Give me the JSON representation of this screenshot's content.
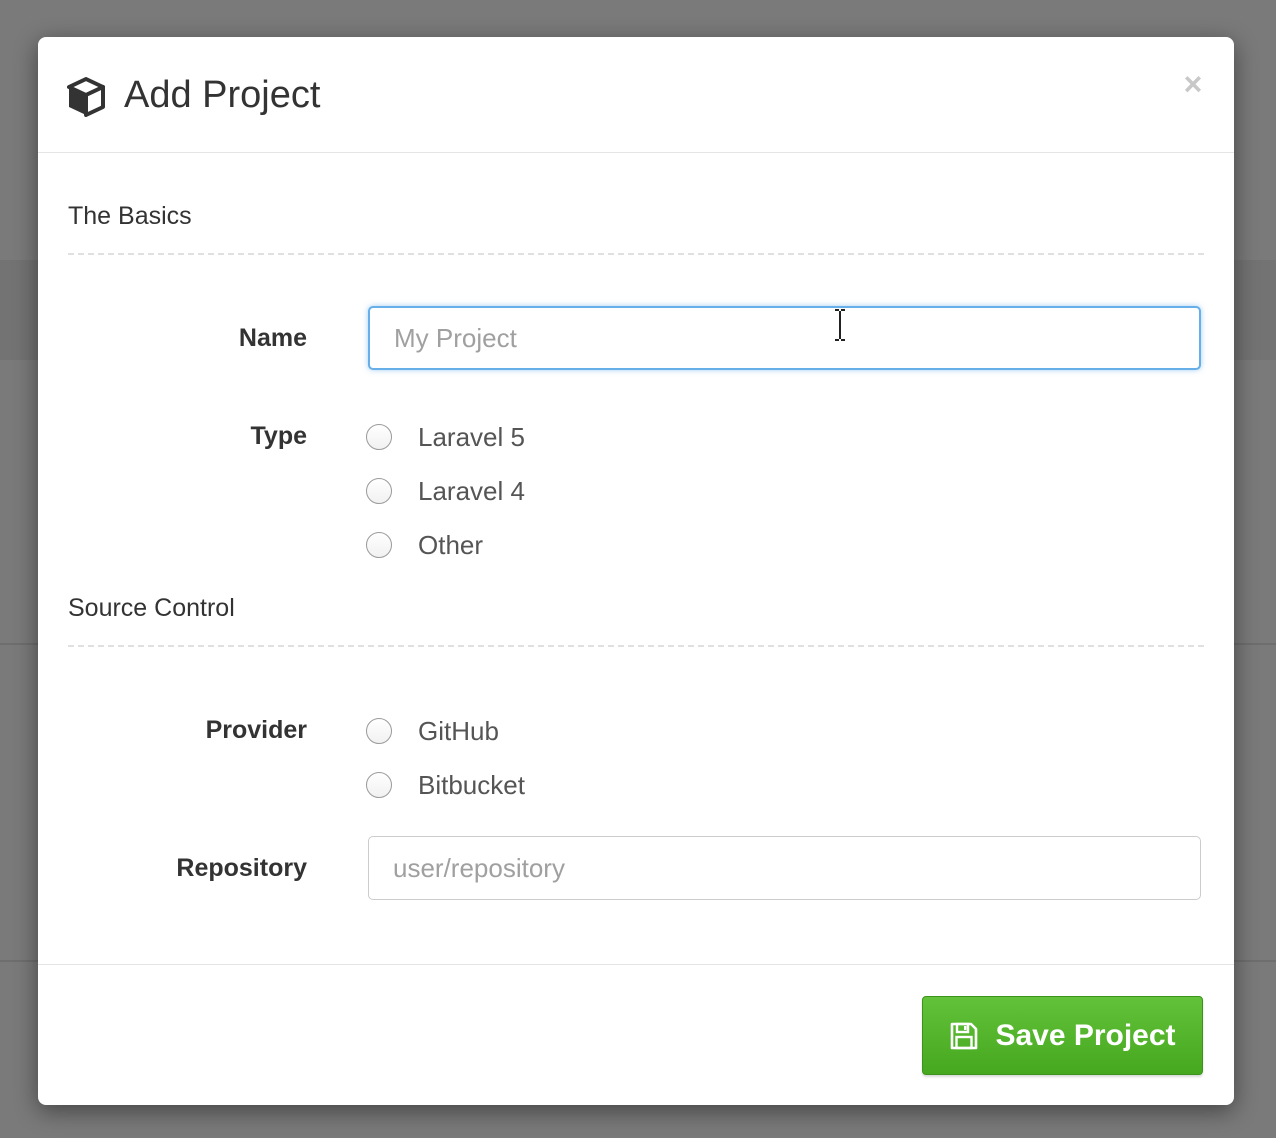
{
  "modal": {
    "title": "Add Project",
    "icon": "cube-icon",
    "close_label": "×"
  },
  "basics": {
    "heading": "The Basics",
    "name_label": "Name",
    "name_placeholder": "My Project",
    "name_value": "",
    "type_label": "Type",
    "type_options": [
      "Laravel 5",
      "Laravel 4",
      "Other"
    ]
  },
  "source_control": {
    "heading": "Source Control",
    "provider_label": "Provider",
    "provider_options": [
      "GitHub",
      "Bitbucket"
    ],
    "repository_label": "Repository",
    "repository_placeholder": "user/repository",
    "repository_value": ""
  },
  "footer": {
    "save_label": "Save Project",
    "save_icon": "floppy-disk-icon"
  },
  "colors": {
    "accent_focus": "#66afe9",
    "save_button": "#4cae26",
    "backdrop": "#7a7a7a"
  }
}
